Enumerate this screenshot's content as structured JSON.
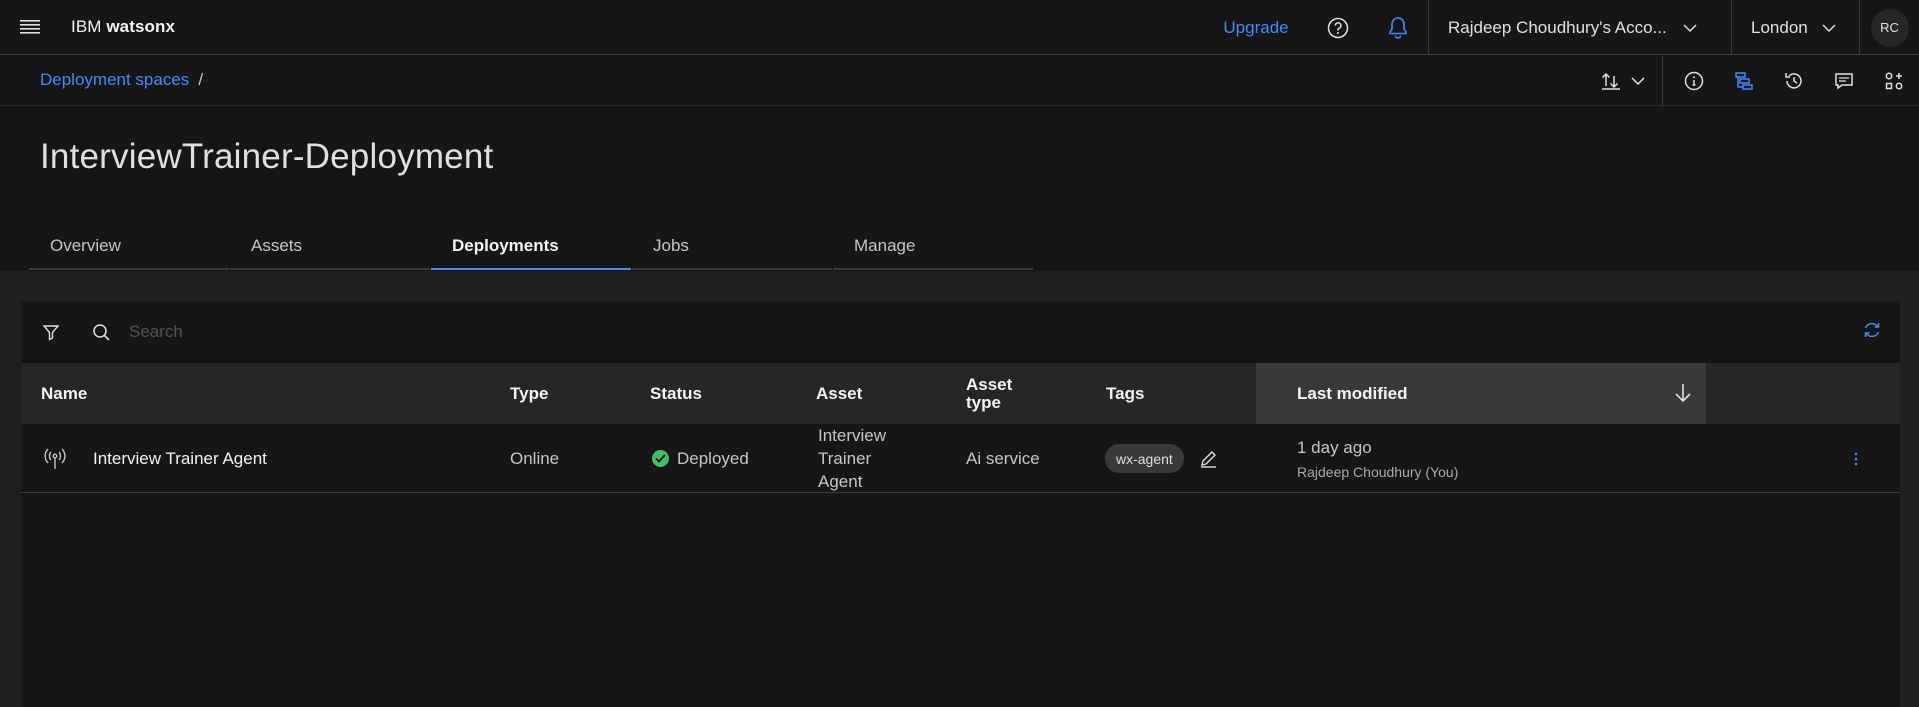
{
  "header": {
    "brand_prefix": "IBM",
    "brand_name": "watsonx",
    "upgrade_label": "Upgrade",
    "account_label": "Rajdeep Choudhury's Acco...",
    "region_label": "London",
    "avatar_initials": "RC"
  },
  "breadcrumb": {
    "items": [
      "Deployment spaces"
    ],
    "separator": "/"
  },
  "page": {
    "title": "InterviewTrainer-Deployment"
  },
  "tabs": [
    {
      "label": "Overview",
      "active": false
    },
    {
      "label": "Assets",
      "active": false
    },
    {
      "label": "Deployments",
      "active": true
    },
    {
      "label": "Jobs",
      "active": false
    },
    {
      "label": "Manage",
      "active": false
    }
  ],
  "search": {
    "placeholder": "Search",
    "value": ""
  },
  "table": {
    "columns": [
      "Name",
      "Type",
      "Status",
      "Asset",
      "Asset type",
      "Tags",
      "Last modified"
    ],
    "sorted_column": "Last modified",
    "sort_direction": "descending",
    "rows": [
      {
        "name": "Interview Trainer Agent",
        "type": "Online",
        "status": "Deployed",
        "asset": "Interview Trainer Agent",
        "asset_type": "Ai service",
        "tag": "wx-agent",
        "last_modified": "1 day ago",
        "modified_by": "Rajdeep Choudhury (You)"
      }
    ]
  },
  "colors": {
    "accent": "#4589ff",
    "success": "#42be65",
    "background": "#161616"
  }
}
